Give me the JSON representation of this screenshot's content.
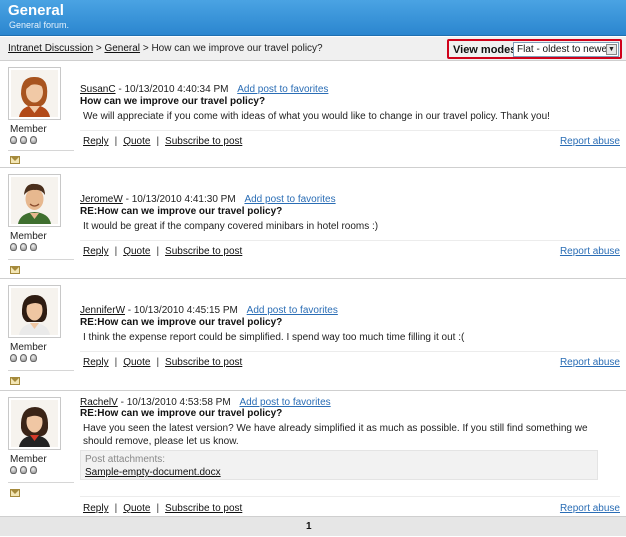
{
  "header": {
    "title": "General",
    "subtitle": "General forum."
  },
  "breadcrumb": {
    "items": [
      {
        "label": "Intranet Discussion"
      },
      {
        "label": "General"
      }
    ],
    "separator": ">",
    "current": "How can we improve our travel policy?"
  },
  "view_modes": {
    "label": "View modes:",
    "selected": "Flat - oldest to newest"
  },
  "labels": {
    "add_favorites": "Add post to favorites",
    "reply": "Reply",
    "quote": "Quote",
    "subscribe": "Subscribe to post",
    "report_abuse": "Report abuse",
    "attachments": "Post attachments:"
  },
  "posts": [
    {
      "author": "SusanC",
      "date": "10/13/2010 4:40:34 PM",
      "role": "Member",
      "subject": "How can we improve our travel policy?",
      "body": "We will appreciate if you come with ideas of what you would like to change in our travel policy. Thank you!"
    },
    {
      "author": "JeromeW",
      "date": "10/13/2010 4:41:30 PM",
      "role": "Member",
      "subject": "RE:How can we improve our travel policy?",
      "body": "It would be great if the company covered minibars in hotel rooms :)"
    },
    {
      "author": "JenniferW",
      "date": "10/13/2010 4:45:15 PM",
      "role": "Member",
      "subject": "RE:How can we improve our travel policy?",
      "body": "I think the expense report could be simplified. I spend way too much time filling it out :("
    },
    {
      "author": "RachelV",
      "date": "10/13/2010 4:53:58 PM",
      "role": "Member",
      "subject": "RE:How can we improve our travel policy?",
      "body": "Have you seen the latest version? We have already simplified it as much as possible. If you still find something we should remove, please let us know.",
      "attachment": "Sample-empty-document.docx"
    }
  ],
  "pager": {
    "current_page": "1"
  },
  "colors": {
    "header": "#2b86cf",
    "link": "#2a6db5",
    "highlight": "#d0021b"
  }
}
